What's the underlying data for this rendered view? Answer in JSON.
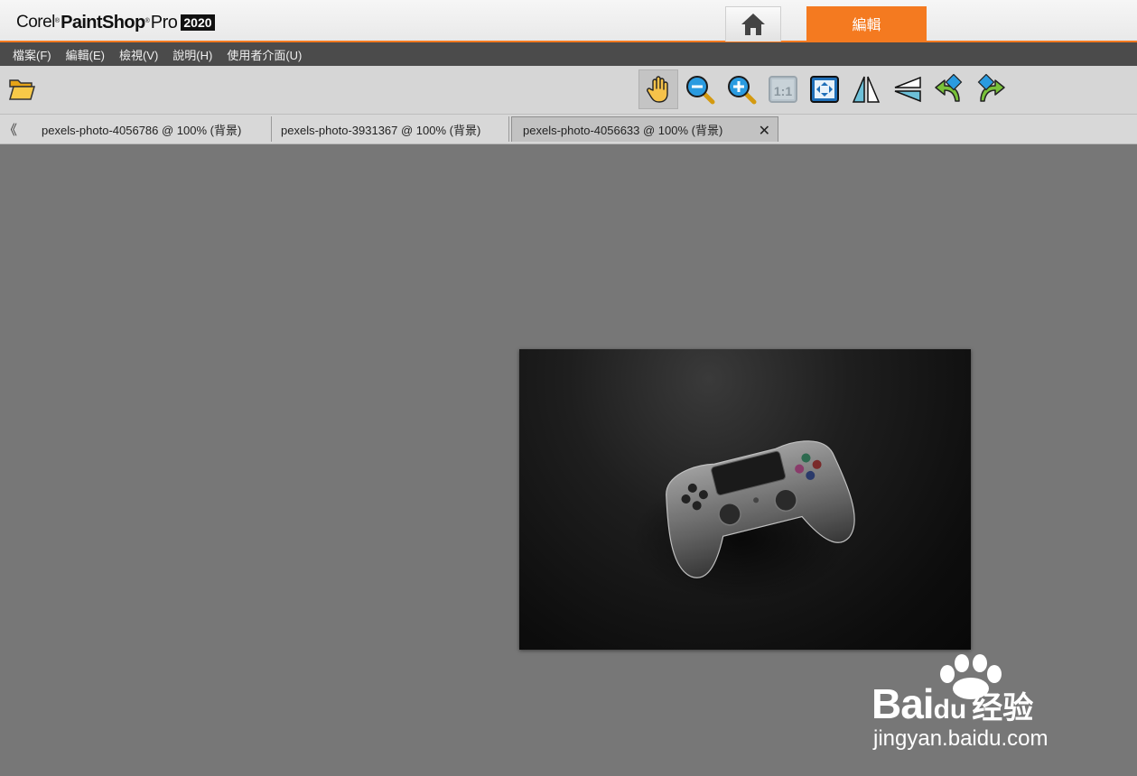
{
  "app": {
    "brand_corel": "Corel",
    "brand_paintshop": "PaintShop",
    "brand_pro": "Pro",
    "reg_mark": "®",
    "year": "2020",
    "home_icon": "home-icon",
    "edit_tab_label": "編輯",
    "accent_color": "#f47a20"
  },
  "menu": {
    "items": [
      {
        "label": "檔案(F)"
      },
      {
        "label": "編輯(E)"
      },
      {
        "label": "檢視(V)"
      },
      {
        "label": "說明(H)"
      },
      {
        "label": "使用者介面(U)"
      }
    ]
  },
  "toolbar": {
    "open_icon": "folder-open-icon",
    "tools": [
      {
        "icon": "pan-hand-icon",
        "active": true
      },
      {
        "icon": "zoom-out-icon"
      },
      {
        "icon": "zoom-in-icon"
      },
      {
        "icon": "actual-size-icon",
        "label": "1:1",
        "disabled": true
      },
      {
        "icon": "fit-to-window-icon"
      },
      {
        "icon": "flip-horizontal-icon"
      },
      {
        "icon": "flip-vertical-icon"
      },
      {
        "icon": "rotate-left-icon"
      },
      {
        "icon": "rotate-right-icon"
      }
    ]
  },
  "tabs": {
    "scroll_left": "《",
    "items": [
      {
        "label": "pexels-photo-4056786 @ 100% (背景)"
      },
      {
        "label": "pexels-photo-3931367 @ 100% (背景)"
      },
      {
        "label": "pexels-photo-4056633 @ 100% (背景)",
        "active": true,
        "close": "✕"
      }
    ]
  },
  "watermark": {
    "bai": "Bai",
    "du": "du",
    "jingyan": "经验",
    "url": "jingyan.baidu.com"
  }
}
